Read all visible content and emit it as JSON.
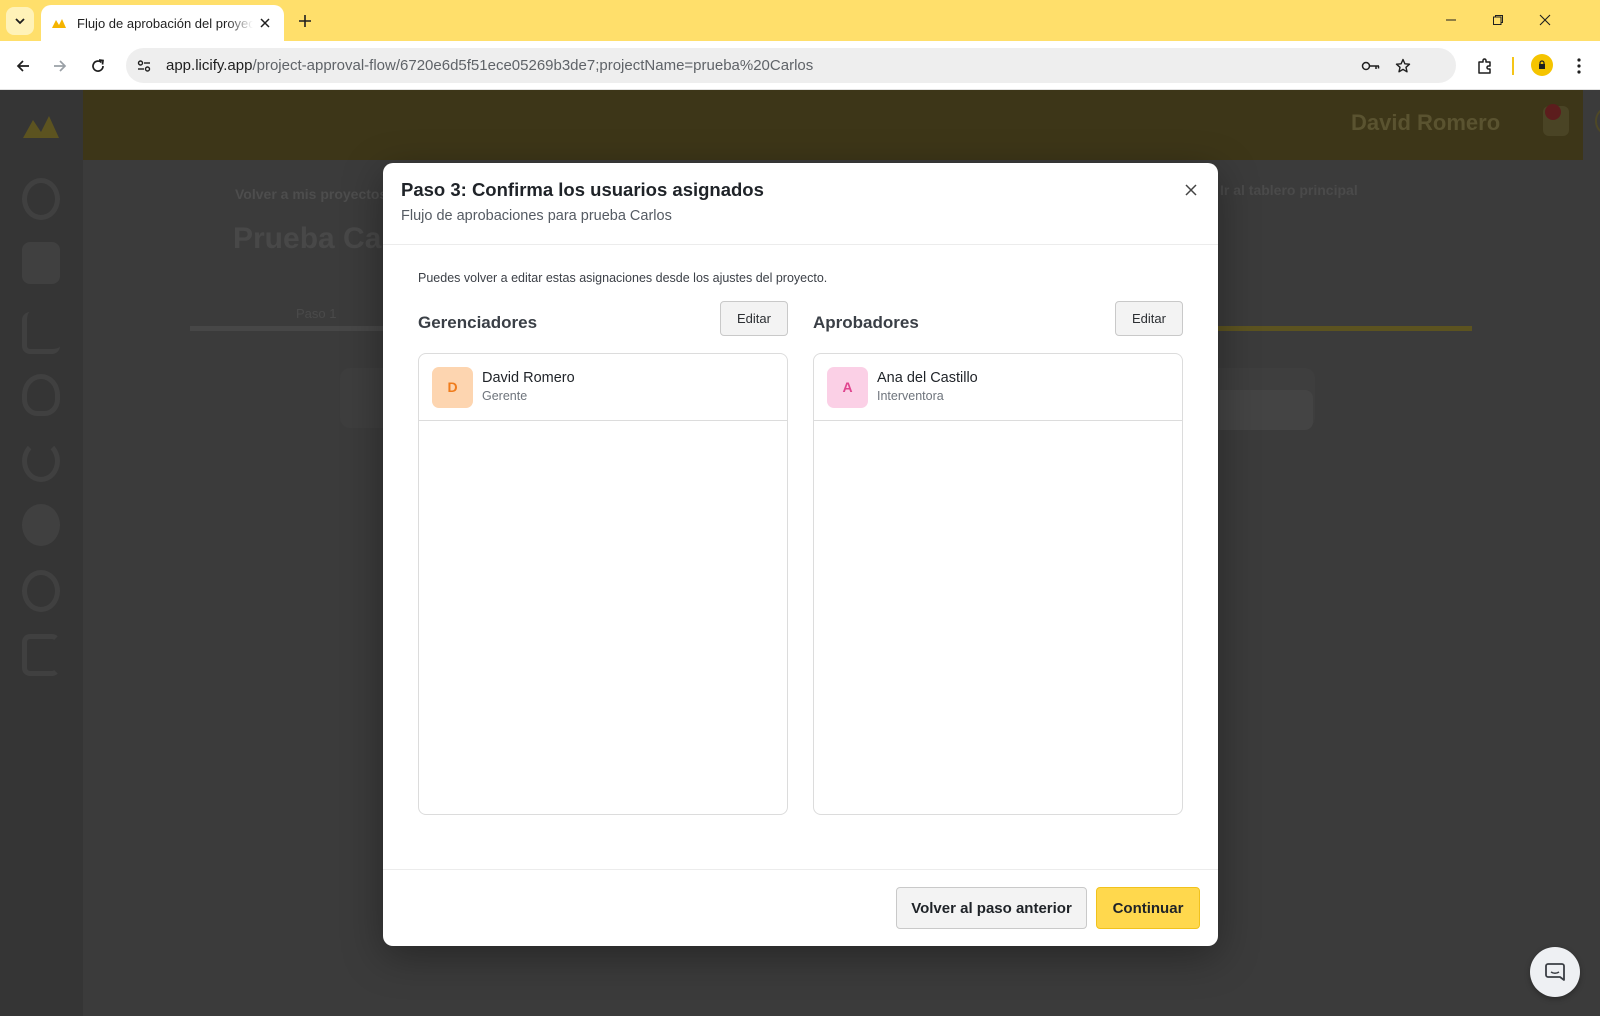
{
  "browser": {
    "tab_title": "Flujo de aprobación del proyecto",
    "url_host": "app.licify.app",
    "url_path": "/project-approval-flow/6720e6d5f51ece05269b3de7;projectName=prueba%20Carlos",
    "icons": [
      "tab-search-icon",
      "licify-favicon",
      "tab-close-icon",
      "new-tab-icon",
      "minimize-icon",
      "restore-icon",
      "window-close-icon",
      "back-icon",
      "forward-icon",
      "reload-icon",
      "site-info-icon",
      "password-key-icon",
      "bookmark-star-icon",
      "extensions-icon",
      "profile-icon",
      "more-menu-icon"
    ],
    "theme_color": "#ffdf6b"
  },
  "background_app": {
    "header_user": "David Romero",
    "back_link": "Volver a mis proyectos",
    "project_title": "Prueba Carlos",
    "right_link": "Ir al tablero principal",
    "step_label": "Paso 1"
  },
  "modal": {
    "title": "Paso 3: Confirma los usuarios asignados",
    "subtitle": "Flujo de aprobaciones para prueba Carlos",
    "note": "Puedes volver a editar estas asignaciones desde los ajustes del proyecto.",
    "managers": {
      "heading": "Gerenciadores",
      "edit_label": "Editar",
      "users": [
        {
          "initial": "D",
          "name": "David Romero",
          "role": "Gerente",
          "avatar_bg": "#fdd5b0",
          "avatar_fg": "#f07c1c"
        }
      ]
    },
    "approvers": {
      "heading": "Aprobadores",
      "edit_label": "Editar",
      "users": [
        {
          "initial": "A",
          "name": "Ana del Castillo",
          "role": "Interventora",
          "avatar_bg": "#fbd0e6",
          "avatar_fg": "#e0458f"
        }
      ]
    },
    "back_button": "Volver al paso anterior",
    "continue_button": "Continuar",
    "accent_color": "#ffd84d"
  },
  "chat_launcher": {
    "icon": "chat-bubble-icon"
  }
}
